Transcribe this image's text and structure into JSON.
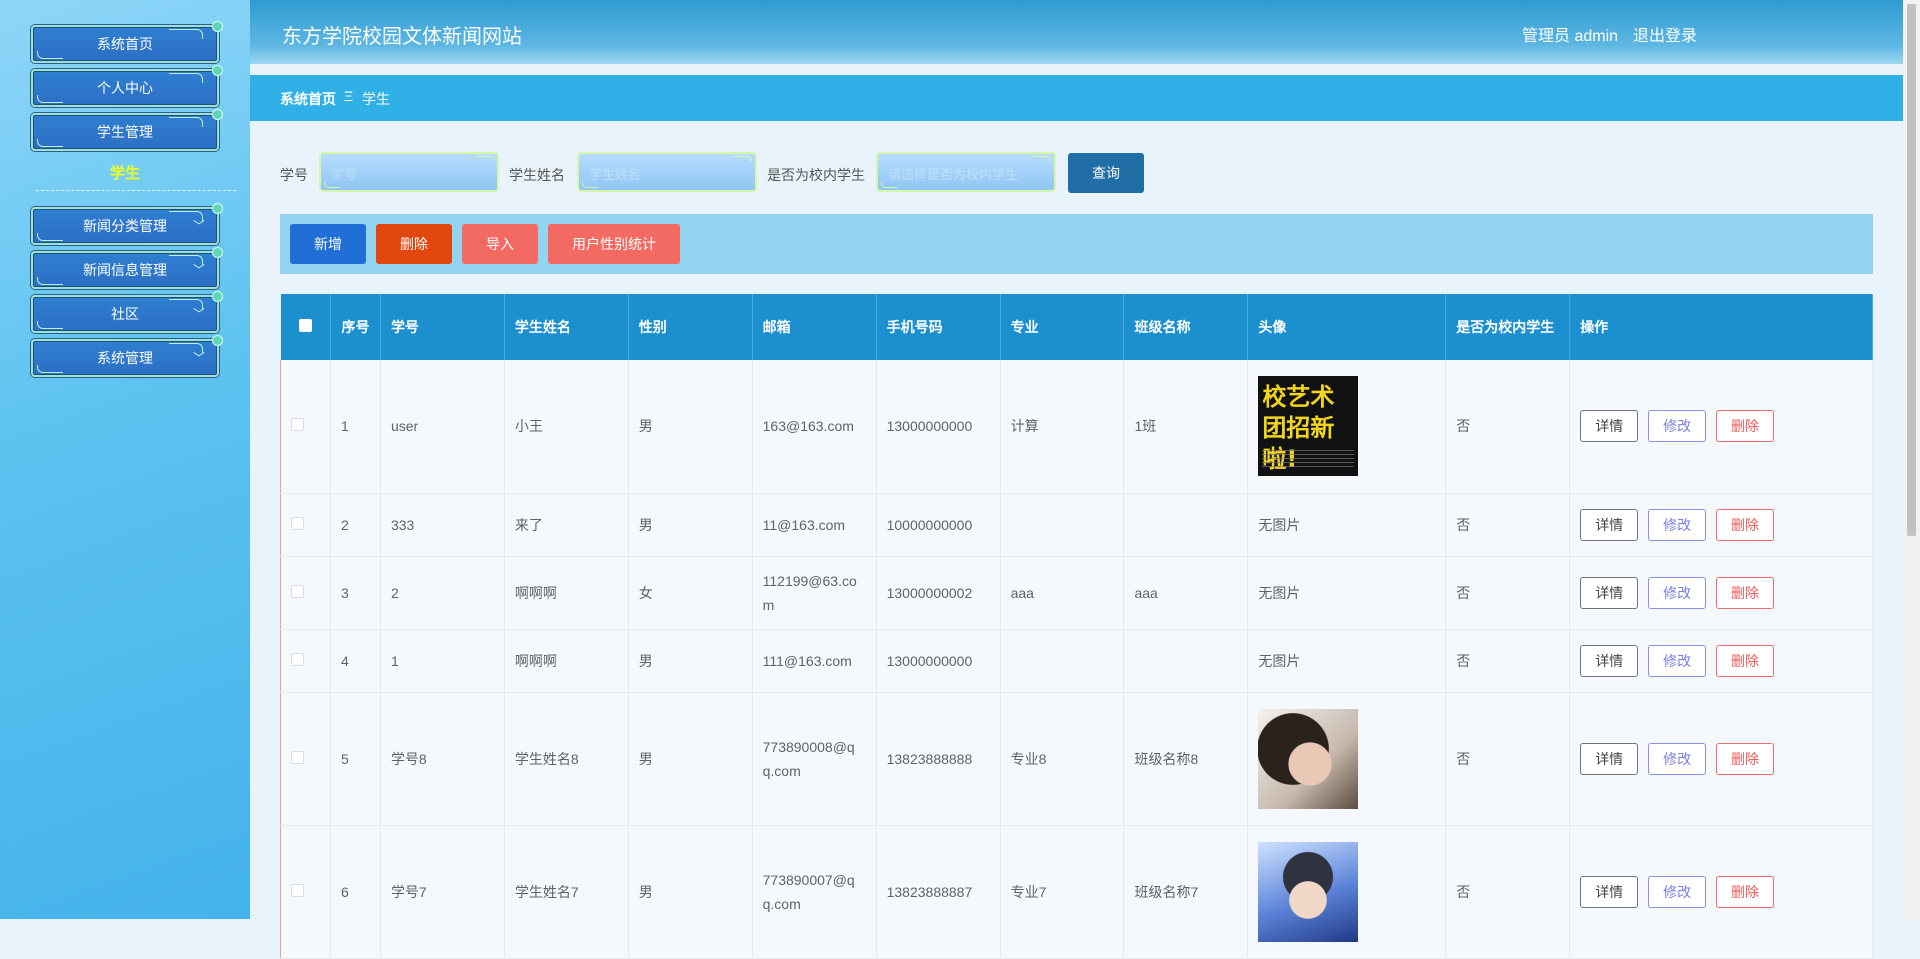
{
  "header": {
    "site_title": "东方学院校园文体新闻网站",
    "user_label": "管理员 admin",
    "logout_label": "退出登录"
  },
  "sidebar": {
    "items": [
      {
        "label": "系统首页"
      },
      {
        "label": "个人中心"
      },
      {
        "label": "学生管理"
      },
      {
        "label": "新闻分类管理"
      },
      {
        "label": "新闻信息管理"
      },
      {
        "label": "社区"
      },
      {
        "label": "系统管理"
      }
    ],
    "sub_item": "学生"
  },
  "breadcrumb": {
    "home": "系统首页",
    "separator": "Ξ",
    "current": "学生"
  },
  "search": {
    "student_id_label": "学号",
    "student_id_placeholder": "学号",
    "student_name_label": "学生姓名",
    "student_name_placeholder": "学生姓名",
    "on_campus_label": "是否为校内学生",
    "on_campus_placeholder": "请选择是否为校内学生",
    "query_button": "查询"
  },
  "actions": {
    "add": "新增",
    "delete": "删除",
    "import": "导入",
    "gender_stats": "用户性别统计"
  },
  "colors": {
    "add": "#1f6fd6",
    "delete": "#e2470f",
    "import": "#f36a63",
    "gender_stats": "#f36a63"
  },
  "table": {
    "columns": [
      "序号",
      "学号",
      "学生姓名",
      "性别",
      "邮箱",
      "手机号码",
      "专业",
      "班级名称",
      "头像",
      "是否为校内学生",
      "操作"
    ],
    "no_image": "无图片",
    "buttons": {
      "detail": "详情",
      "edit": "修改",
      "delete": "删除"
    },
    "poster_text": "校艺术团招新啦!",
    "rows": [
      {
        "no": "1",
        "id": "user",
        "name": "小王",
        "gender": "男",
        "email": "163@163.com",
        "phone": "13000000000",
        "major": "计算",
        "class": "1班",
        "avatar": "poster",
        "campus": "否"
      },
      {
        "no": "2",
        "id": "333",
        "name": "来了",
        "gender": "男",
        "email": "11@163.com",
        "phone": "10000000000",
        "major": "",
        "class": "",
        "avatar": "none",
        "campus": "否"
      },
      {
        "no": "3",
        "id": "2",
        "name": "啊啊啊",
        "gender": "女",
        "email": "112199@63.com",
        "phone": "13000000002",
        "major": "aaa",
        "class": "aaa",
        "avatar": "none",
        "campus": "否"
      },
      {
        "no": "4",
        "id": "1",
        "name": "啊啊啊",
        "gender": "男",
        "email": "111@163.com",
        "phone": "13000000000",
        "major": "",
        "class": "",
        "avatar": "none",
        "campus": "否"
      },
      {
        "no": "5",
        "id": "学号8",
        "name": "学生姓名8",
        "gender": "男",
        "email": "773890008@qq.com",
        "phone": "13823888888",
        "major": "专业8",
        "class": "班级名称8",
        "avatar": "girl",
        "campus": "否"
      },
      {
        "no": "6",
        "id": "学号7",
        "name": "学生姓名7",
        "gender": "男",
        "email": "773890007@qq.com",
        "phone": "13823888887",
        "major": "专业7",
        "class": "班级名称7",
        "avatar": "boy",
        "campus": "否"
      }
    ]
  }
}
